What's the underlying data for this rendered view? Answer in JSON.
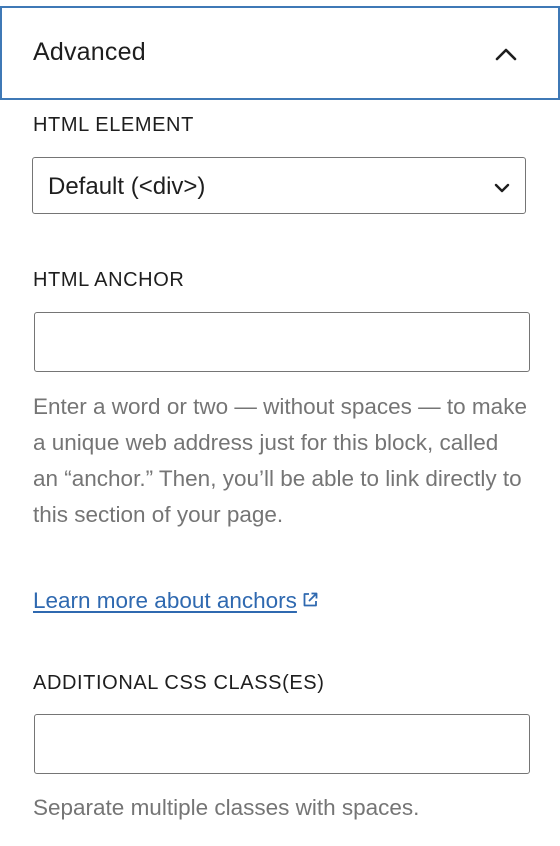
{
  "panel": {
    "title": "Advanced",
    "expanded": true,
    "toggle_icon": "chevron-up-icon"
  },
  "html_element": {
    "label": "HTML ELEMENT",
    "selected": "Default (<div>)",
    "dropdown_icon": "chevron-down-icon"
  },
  "html_anchor": {
    "label": "HTML ANCHOR",
    "value": "",
    "help": "Enter a word or two — without spaces — to make a unique web address just for this block, called an “anchor.” Then, you’ll be able to link directly to this section of your page.",
    "link_text": "Learn more about anchors",
    "link_icon": "external-link-icon"
  },
  "css_classes": {
    "label": "ADDITIONAL CSS CLASS(ES)",
    "value": "",
    "help": "Separate multiple classes with spaces."
  },
  "colors": {
    "focus_border": "#3f79b6",
    "link": "#2f69b0",
    "help_text": "#757575",
    "text": "#1e1e1e",
    "input_border": "#757575"
  }
}
